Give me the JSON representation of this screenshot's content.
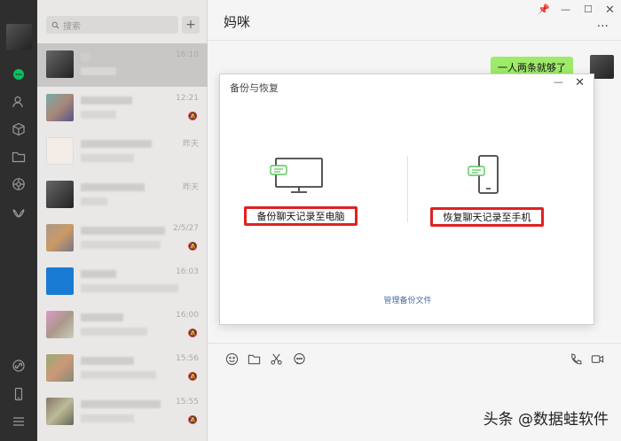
{
  "search": {
    "placeholder": "搜索"
  },
  "list": {
    "items": [
      {
        "time": "16:10",
        "muted": false,
        "active": true
      },
      {
        "time": "12:21",
        "muted": true,
        "active": false
      },
      {
        "time": "昨天",
        "muted": false,
        "active": false
      },
      {
        "time": "昨天",
        "muted": false,
        "active": false
      },
      {
        "time": "2/5/27",
        "muted": true,
        "active": false
      },
      {
        "time": "16:03",
        "muted": false,
        "active": false
      },
      {
        "time": "16:00",
        "muted": true,
        "active": false
      },
      {
        "time": "15:56",
        "muted": true,
        "active": false
      },
      {
        "time": "15:55",
        "muted": true,
        "active": false
      }
    ]
  },
  "chat": {
    "title": "妈咪",
    "bubble_text": "一人两条就够了"
  },
  "dialog": {
    "title": "备份与恢复",
    "backup_label": "备份聊天记录至电脑",
    "restore_label": "恢复聊天记录至手机",
    "manage_label": "管理备份文件"
  },
  "watermark": "头条 @数据蛙软件",
  "colors": {
    "highlight": "#e02020",
    "bubble": "#9eea6a",
    "link": "#4a6fa5"
  }
}
